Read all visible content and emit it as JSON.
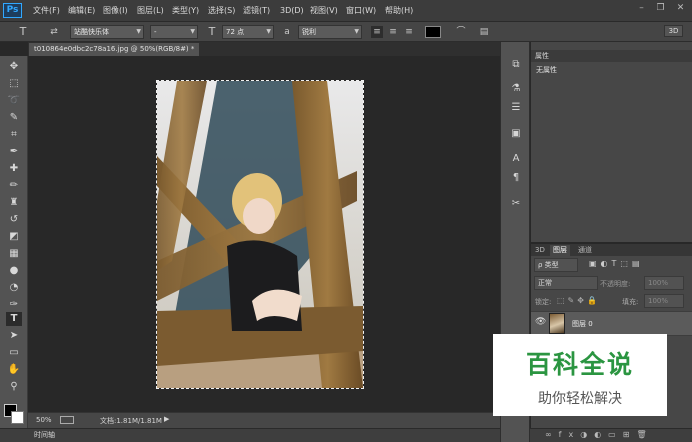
{
  "app": {
    "logo": "Ps"
  },
  "menu": [
    "文件(F)",
    "编辑(E)",
    "图像(I)",
    "图层(L)",
    "类型(Y)",
    "选择(S)",
    "滤镜(T)",
    "3D(D)",
    "视图(V)",
    "窗口(W)",
    "帮助(H)"
  ],
  "window_controls": {
    "minimize": "–",
    "restore": "❐",
    "close": "✕"
  },
  "options": {
    "tool_glyph": "T",
    "orient_glyph": "⇄",
    "font_family": "站酷快乐体",
    "font_style": "-",
    "size_glyph": "T",
    "font_size": "72 点",
    "aa_glyph": "a",
    "antialias": "锐利",
    "text_color": "#000000",
    "btn_3d": "3D"
  },
  "document": {
    "tab_title": "t010864e0dbc2c78a16.jpg @ 50%(RGB/8#) *",
    "close_glyph": "×"
  },
  "status": {
    "zoom": "50%",
    "doc_info": "文档:1.81M/1.81M"
  },
  "timeline": {
    "label": "时间轴"
  },
  "properties": {
    "tab": "属性",
    "header": "无属性"
  },
  "layers": {
    "tabs": [
      "3D",
      "图层",
      "通道"
    ],
    "filter": "ρ 类型",
    "blend": "正常",
    "opacity_label": "不透明度:",
    "opacity": "100%",
    "lock_label": "锁定:",
    "fill_label": "填充:",
    "fill": "100%",
    "layer_name": "图层 0"
  },
  "watermark": {
    "line1": "百科全说",
    "line2": "助你轻松解决"
  },
  "icons": {
    "tools": [
      "move-icon",
      "marquee-icon",
      "lasso-icon",
      "quick-select-icon",
      "crop-icon",
      "eyedropper-icon",
      "healing-icon",
      "brush-icon",
      "stamp-icon",
      "history-brush-icon",
      "eraser-icon",
      "gradient-icon",
      "blur-icon",
      "dodge-icon",
      "pen-icon",
      "type-icon",
      "path-select-icon",
      "shape-icon",
      "hand-icon",
      "zoom-icon"
    ]
  }
}
